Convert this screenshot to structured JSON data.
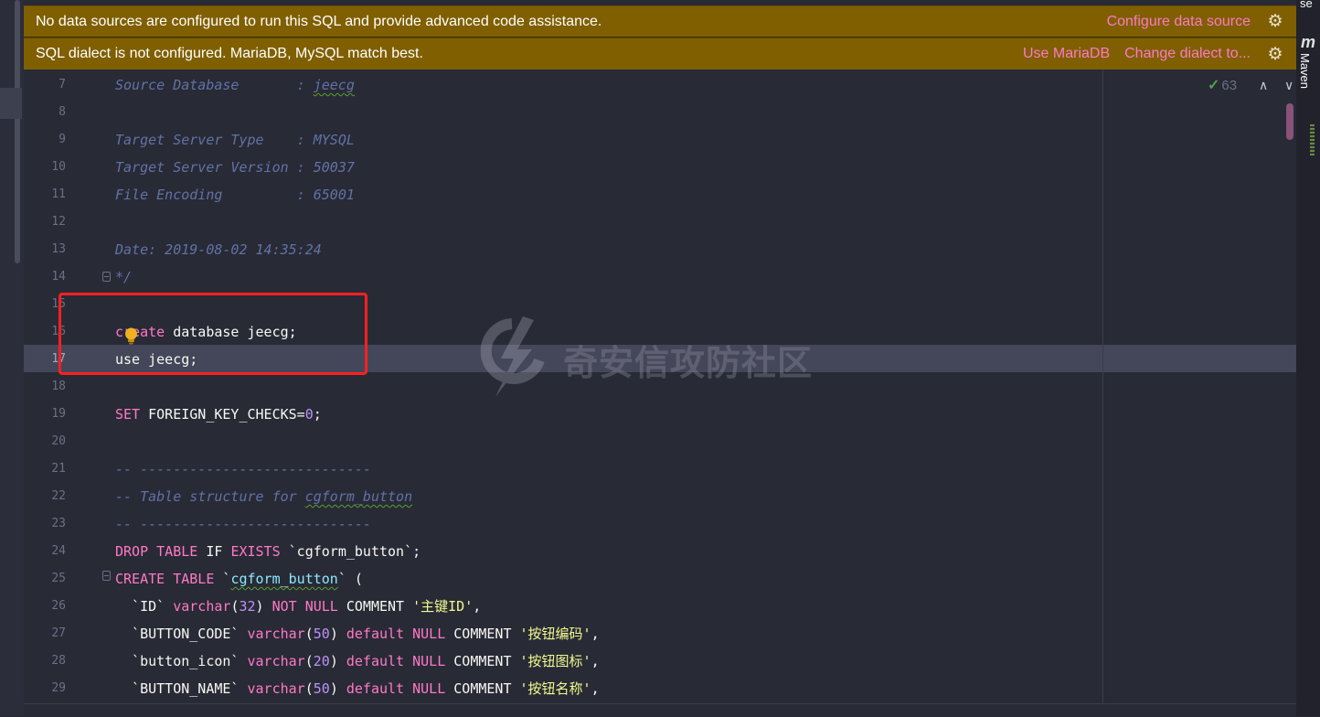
{
  "banners": {
    "datasource": {
      "message": "No data sources are configured to run this SQL and provide advanced code assistance.",
      "action": "Configure data source"
    },
    "dialect": {
      "message": "SQL dialect is not configured. MariaDB, MySQL match best.",
      "action_primary": "Use MariaDB",
      "action_secondary": "Change dialect to..."
    }
  },
  "tool_window": {
    "top_tab_fragment": "se",
    "maven_icon": "m",
    "maven_label": "Maven"
  },
  "inspections": {
    "count": "63",
    "check_icon": "✓",
    "up_icon": "∧",
    "down_icon": "∨"
  },
  "watermark": "奇安信攻防社区",
  "editor": {
    "current_line": "17",
    "lines": [
      {
        "n": "7"
      },
      {
        "n": "8"
      },
      {
        "n": "9"
      },
      {
        "n": "10"
      },
      {
        "n": "11"
      },
      {
        "n": "12"
      },
      {
        "n": "13"
      },
      {
        "n": "14"
      },
      {
        "n": "15"
      },
      {
        "n": "16"
      },
      {
        "n": "17"
      },
      {
        "n": "18"
      },
      {
        "n": "19"
      },
      {
        "n": "20"
      },
      {
        "n": "21"
      },
      {
        "n": "22"
      },
      {
        "n": "23"
      },
      {
        "n": "24"
      },
      {
        "n": "25"
      },
      {
        "n": "26"
      },
      {
        "n": "27"
      },
      {
        "n": "28"
      },
      {
        "n": "29"
      }
    ],
    "t": {
      "l7a": "Source Database       : ",
      "l7b": "jeecg",
      "l9": "Target Server Type    : MYSQL",
      "l10": "Target Server Version : 50037",
      "l11": "File Encoding         : 65001",
      "l13": "Date: 2019-08-02 14:35:24",
      "l14": "*/",
      "l16a": "create",
      "l16b": " database jeecg;",
      "l17": "use jeecg;",
      "l19a": "SET",
      "l19b": " FOREIGN_KEY_CHECKS=",
      "l19c": "0",
      "l19d": ";",
      "l21": "-- ----------------------------",
      "l22a": "-- Table structure for ",
      "l22b": "cgform_button",
      "l23": "-- ----------------------------",
      "l24a": "DROP TABLE",
      "l24b": " IF ",
      "l24c": "EXISTS",
      "l24d": " `cgform_button`;",
      "l25a": "CREATE TABLE",
      "l25b": " `",
      "l25c": "cgform_button",
      "l25d": "` (",
      "l26a": "  `ID` ",
      "l26b": "varchar",
      "l26c": "(",
      "l26d": "32",
      "l26e": ") ",
      "l26f": "NOT NULL",
      "l26g": " COMMENT ",
      "l26h": "'主键ID'",
      "l26i": ",",
      "l27a": "  `BUTTON_CODE` ",
      "l27b": "varchar",
      "l27c": "(",
      "l27d": "50",
      "l27e": ") ",
      "l27f": "default NULL",
      "l27g": " COMMENT ",
      "l27h": "'按钮编码'",
      "l27i": ",",
      "l28a": "  `button_icon` ",
      "l28b": "varchar",
      "l28c": "(",
      "l28d": "20",
      "l28e": ") ",
      "l28f": "default NULL",
      "l28g": " COMMENT ",
      "l28h": "'按钮图标'",
      "l28i": ",",
      "l29a": "  `BUTTON_NAME` ",
      "l29b": "varchar",
      "l29c": "(",
      "l29d": "50",
      "l29e": ") ",
      "l29f": "default NULL",
      "l29g": " COMMENT ",
      "l29h": "'按钮名称'",
      "l29i": ","
    }
  }
}
